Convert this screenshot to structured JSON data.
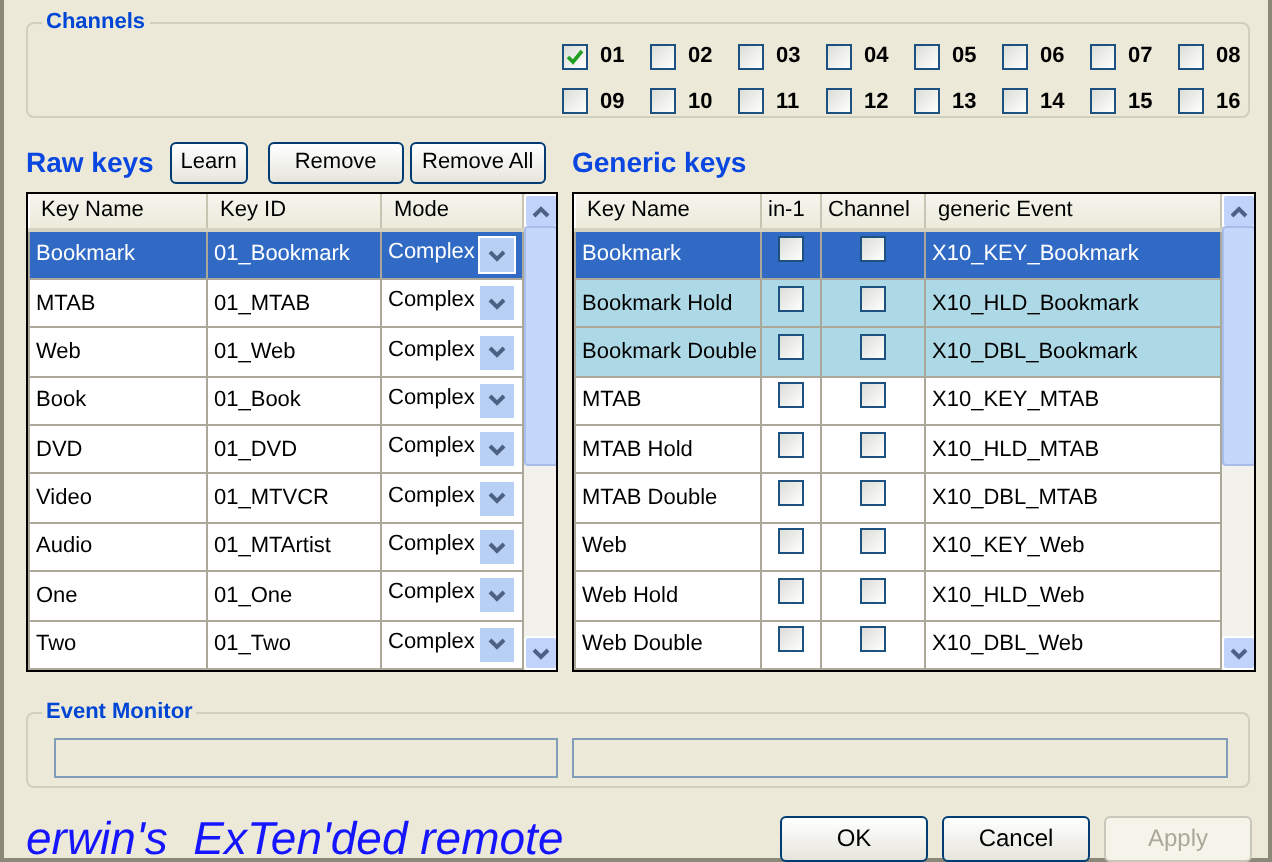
{
  "channels": {
    "title": "Channels",
    "items": [
      {
        "label": "01",
        "checked": true
      },
      {
        "label": "02",
        "checked": false
      },
      {
        "label": "03",
        "checked": false
      },
      {
        "label": "04",
        "checked": false
      },
      {
        "label": "05",
        "checked": false
      },
      {
        "label": "06",
        "checked": false
      },
      {
        "label": "07",
        "checked": false
      },
      {
        "label": "08",
        "checked": false
      },
      {
        "label": "09",
        "checked": false
      },
      {
        "label": "10",
        "checked": false
      },
      {
        "label": "11",
        "checked": false
      },
      {
        "label": "12",
        "checked": false
      },
      {
        "label": "13",
        "checked": false
      },
      {
        "label": "14",
        "checked": false
      },
      {
        "label": "15",
        "checked": false
      },
      {
        "label": "16",
        "checked": false
      }
    ]
  },
  "raw_keys": {
    "title": "Raw keys",
    "buttons": [
      "Learn",
      "Remove",
      "Remove All"
    ],
    "columns": [
      "Key Name",
      "Key ID",
      "Mode"
    ],
    "rows": [
      {
        "key_name": "Bookmark",
        "key_id": "01_Bookmark",
        "mode": "Complex",
        "selected": true
      },
      {
        "key_name": "MTAB",
        "key_id": "01_MTAB",
        "mode": "Complex",
        "selected": false
      },
      {
        "key_name": "Web",
        "key_id": "01_Web",
        "mode": "Complex",
        "selected": false
      },
      {
        "key_name": "Book",
        "key_id": "01_Book",
        "mode": "Complex",
        "selected": false
      },
      {
        "key_name": "DVD",
        "key_id": "01_DVD",
        "mode": "Complex",
        "selected": false
      },
      {
        "key_name": "Video",
        "key_id": "01_MTVCR",
        "mode": "Complex",
        "selected": false
      },
      {
        "key_name": "Audio",
        "key_id": "01_MTArtist",
        "mode": "Complex",
        "selected": false
      },
      {
        "key_name": "One",
        "key_id": "01_One",
        "mode": "Complex",
        "selected": false
      },
      {
        "key_name": "Two",
        "key_id": "01_Two",
        "mode": "Complex",
        "selected": false
      }
    ]
  },
  "generic_keys": {
    "title": "Generic keys",
    "columns": [
      "Key Name",
      "in-1",
      "Channel",
      "generic Event"
    ],
    "rows": [
      {
        "key_name": "Bookmark",
        "in_1": false,
        "channel": false,
        "generic_event": "X10_KEY_Bookmark",
        "selected": true,
        "highlighted": false
      },
      {
        "key_name": "Bookmark Hold",
        "in_1": false,
        "channel": false,
        "generic_event": "X10_HLD_Bookmark",
        "selected": false,
        "highlighted": true
      },
      {
        "key_name": "Bookmark Double",
        "in_1": false,
        "channel": false,
        "generic_event": "X10_DBL_Bookmark",
        "selected": false,
        "highlighted": true
      },
      {
        "key_name": "MTAB",
        "in_1": false,
        "channel": false,
        "generic_event": "X10_KEY_MTAB",
        "selected": false,
        "highlighted": false
      },
      {
        "key_name": "MTAB Hold",
        "in_1": false,
        "channel": false,
        "generic_event": "X10_HLD_MTAB",
        "selected": false,
        "highlighted": false
      },
      {
        "key_name": "MTAB Double",
        "in_1": false,
        "channel": false,
        "generic_event": "X10_DBL_MTAB",
        "selected": false,
        "highlighted": false
      },
      {
        "key_name": "Web",
        "in_1": false,
        "channel": false,
        "generic_event": "X10_KEY_Web",
        "selected": false,
        "highlighted": false
      },
      {
        "key_name": "Web Hold",
        "in_1": false,
        "channel": false,
        "generic_event": "X10_HLD_Web",
        "selected": false,
        "highlighted": false
      },
      {
        "key_name": "Web Double",
        "in_1": false,
        "channel": false,
        "generic_event": "X10_DBL_Web",
        "selected": false,
        "highlighted": false
      }
    ]
  },
  "event_monitor": {
    "title": "Event Monitor"
  },
  "footer": {
    "brand": "erwin's  ExTen'ded remote",
    "buttons": [
      {
        "label": "OK",
        "disabled": false
      },
      {
        "label": "Cancel",
        "disabled": false
      },
      {
        "label": "Apply",
        "disabled": true
      }
    ]
  }
}
